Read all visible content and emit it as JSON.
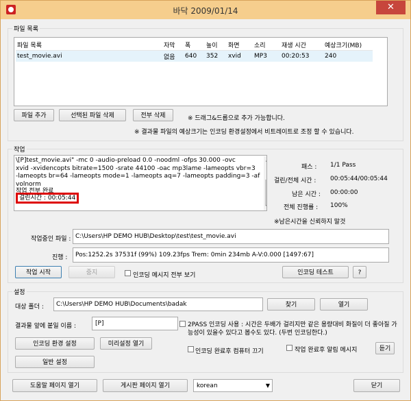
{
  "window": {
    "title": "바닥 2009/01/14",
    "close_symbol": "✕"
  },
  "file_list": {
    "group_label": "파일 목록",
    "columns": [
      "파일 목록",
      "자막",
      "폭",
      "높이",
      "화면",
      "소리",
      "재생 시간",
      "예상크기(MB)"
    ],
    "rows": [
      [
        "test_movie.avi",
        "없음",
        "640",
        "352",
        "xvid",
        "MP3",
        "00:20:53",
        "240"
      ]
    ],
    "add_file_button": "파일 추가",
    "delete_selected_button": "선택된 파일 삭제",
    "delete_all_button": "전부 삭제",
    "drag_hint": "※ 드래그&드롭으로 추가 가능합니다.",
    "size_note": "※ 결과물 파일의 예상크기는 인코딩 환경설정에서 비트레이트로 조정 할 수 있습니다."
  },
  "job": {
    "group_label": "작업",
    "log_lines": [
      "\\[P]test_movie.avi\" -mc 0 -audio-preload 0.0 -noodml -ofps 30.000 -ovc",
      "xvid -xvidencopts bitrate=1500 -srate 44100 -oac mp3lame -lameopts vbr=3",
      "-lameopts br=64 -lameopts mode=1 -lameopts aq=7 -lameopts padding=3 -af",
      "volnorm",
      "작업 전부 완료"
    ],
    "elapsed_line": "걸린시간 : 00:05:44",
    "pass_label": "패스 :",
    "pass_value": "1/1 Pass",
    "elapsed_total_label": "걸린/전체 시간 :",
    "elapsed_total_value": "00:05:44/00:05:44",
    "remaining_label": "남은 시간 :",
    "remaining_value": "00:00:00",
    "overall_progress_label": "전체 진행률 :",
    "overall_progress_value": "100%",
    "remaining_note": "※남은시간을 신뢰하지 말것",
    "current_file_label": "작업중인 파일 :",
    "current_file_value": "C:\\Users\\HP DEMO HUB\\Desktop\\test\\test_movie.avi",
    "progress_label": "진행 :",
    "progress_value": "Pos:1252.2s  37531f (99%) 109.23fps Trem:    0min 234mb  A-V:0.000 [1497:67]",
    "start_button": "작업 시작",
    "stop_button": "중지",
    "show_all_messages": "인코딩 메시지 전부 보기",
    "encoding_test_button": "인코딩 테스트",
    "help_button": "?"
  },
  "settings": {
    "group_label": "설정",
    "target_folder_label": "대상 폴더 :",
    "target_folder_value": "C:\\Users\\HP DEMO HUB\\Documents\\badak",
    "browse_button": "찾기",
    "open_button": "열기",
    "prefix_label": "결과물 앞에 붙일 이름 :",
    "prefix_value": "[P]",
    "twopass_line1": "2PASS 인코딩 사용 : 시간은 두배가 걸리지만 같은 용량대비 화질이 더 좋아질 가",
    "twopass_line2": "능성이 있을수 있다고 봅수도 있다. (두번 인코딩한다.)",
    "encoding_settings_button": "인코딩 환경 설정",
    "preset_button": "미리설정 열기",
    "general_settings_button": "일반 설정",
    "shutdown_after": "인코딩 완료후 컴퓨터 끄기",
    "notify_after": "작업 완료후 알림 메시지",
    "listen_button": "듣기"
  },
  "footer": {
    "help_page_button": "도움말 페이지 열기",
    "board_page_button": "게시판 페이지 열기",
    "language_value": "korean",
    "close_button": "닫기"
  }
}
